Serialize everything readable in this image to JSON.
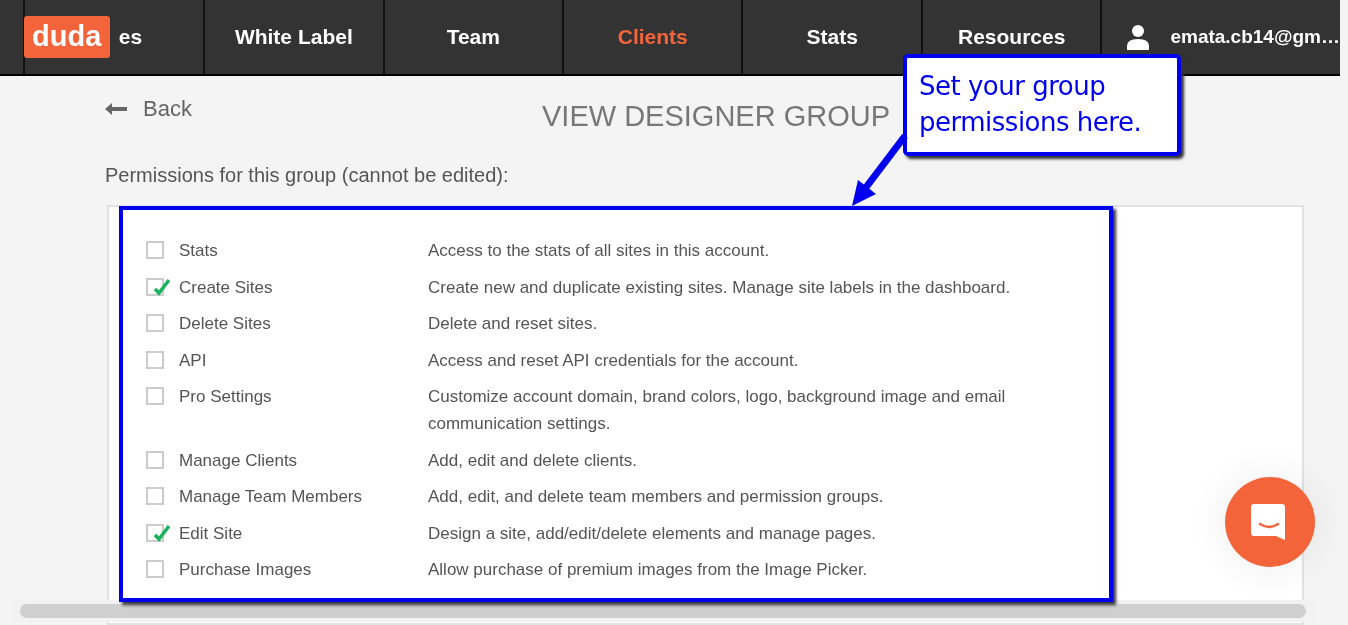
{
  "nav": {
    "logo": "duda",
    "tabs": [
      {
        "label": "es",
        "selected": false
      },
      {
        "label": "White Label",
        "selected": false
      },
      {
        "label": "Team",
        "selected": false
      },
      {
        "label": "Clients",
        "selected": true
      },
      {
        "label": "Stats",
        "selected": false
      },
      {
        "label": "Resources",
        "selected": false
      }
    ],
    "user": "emata.cb14@gm…"
  },
  "back": "Back",
  "title": "VIEW DESIGNER GROUP",
  "subtitle": "Permissions for this group (cannot be edited):",
  "permissions": [
    {
      "name": "Stats",
      "description": "Access to the stats of all sites in this account.",
      "checked": false
    },
    {
      "name": "Create Sites",
      "description": "Create new and duplicate existing sites. Manage site labels in the dashboard.",
      "checked": true
    },
    {
      "name": "Delete Sites",
      "description": "Delete and reset sites.",
      "checked": false
    },
    {
      "name": "API",
      "description": "Access and reset API credentials for the account.",
      "checked": false
    },
    {
      "name": "Pro Settings",
      "description": "Customize account domain, brand colors, logo, background image and email communication settings.",
      "checked": false
    },
    {
      "name": "Manage Clients",
      "description": "Add, edit and delete clients.",
      "checked": false
    },
    {
      "name": "Manage Team Members",
      "description": "Add, edit, and delete team members and permission groups.",
      "checked": false
    },
    {
      "name": "Edit Site",
      "description": "Design a site, add/edit/delete elements and manage pages.",
      "checked": true
    },
    {
      "name": "Purchase Images",
      "description": "Allow purchase of premium images from the Image Picker.",
      "checked": false
    }
  ],
  "callout": {
    "text": "Set your group permissions here."
  }
}
